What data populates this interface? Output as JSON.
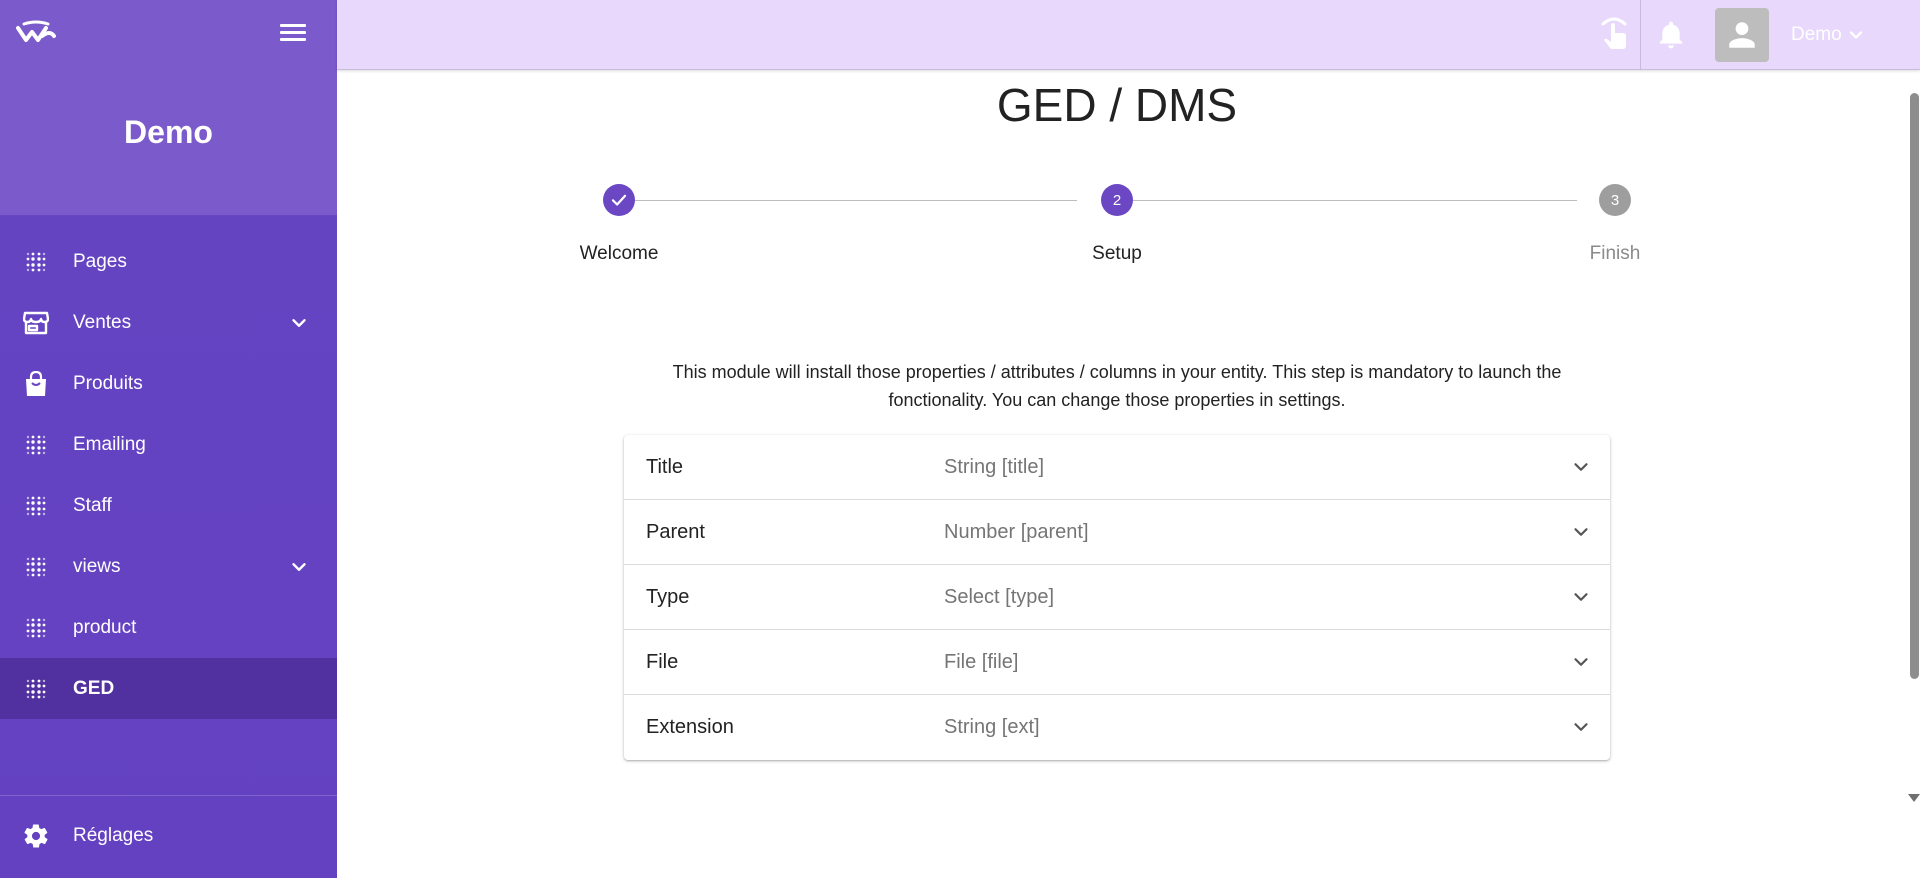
{
  "sidebar": {
    "brand": "Demo",
    "items": [
      {
        "label": "Pages",
        "icon": "dots-grid-icon",
        "expandable": false,
        "active": false
      },
      {
        "label": "Ventes",
        "icon": "store-icon",
        "expandable": true,
        "active": false
      },
      {
        "label": "Produits",
        "icon": "shopping-bag-icon",
        "expandable": false,
        "active": false
      },
      {
        "label": "Emailing",
        "icon": "dots-grid-icon",
        "expandable": false,
        "active": false
      },
      {
        "label": "Staff",
        "icon": "dots-grid-icon",
        "expandable": false,
        "active": false
      },
      {
        "label": "views",
        "icon": "dots-grid-icon",
        "expandable": true,
        "active": false
      },
      {
        "label": "product",
        "icon": "dots-grid-icon",
        "expandable": false,
        "active": false
      },
      {
        "label": "GED",
        "icon": "dots-grid-icon",
        "expandable": false,
        "active": true
      }
    ],
    "settings_label": "Réglages"
  },
  "header": {
    "user_name": "Demo"
  },
  "main": {
    "title": "GED / DMS",
    "steps": [
      {
        "label": "Welcome",
        "state": "done",
        "number": "1"
      },
      {
        "label": "Setup",
        "state": "active",
        "number": "2"
      },
      {
        "label": "Finish",
        "state": "pending",
        "number": "3"
      }
    ],
    "description": "This module will install those properties / attributes / columns in your entity. This step is mandatory to launch the fonctionality. You can change those properties in settings.",
    "properties": [
      {
        "name": "Title",
        "value": "String [title]"
      },
      {
        "name": "Parent",
        "value": "Number [parent]"
      },
      {
        "name": "Type",
        "value": "Select [type]"
      },
      {
        "name": "File",
        "value": "File [file]"
      },
      {
        "name": "Extension",
        "value": "String [ext]"
      }
    ]
  },
  "colors": {
    "sidebar": "#6b47c4",
    "sidebar_active": "#51309f",
    "header": "#e8d8fc",
    "accent": "#6b47c4",
    "step_pending": "#9e9e9e"
  }
}
